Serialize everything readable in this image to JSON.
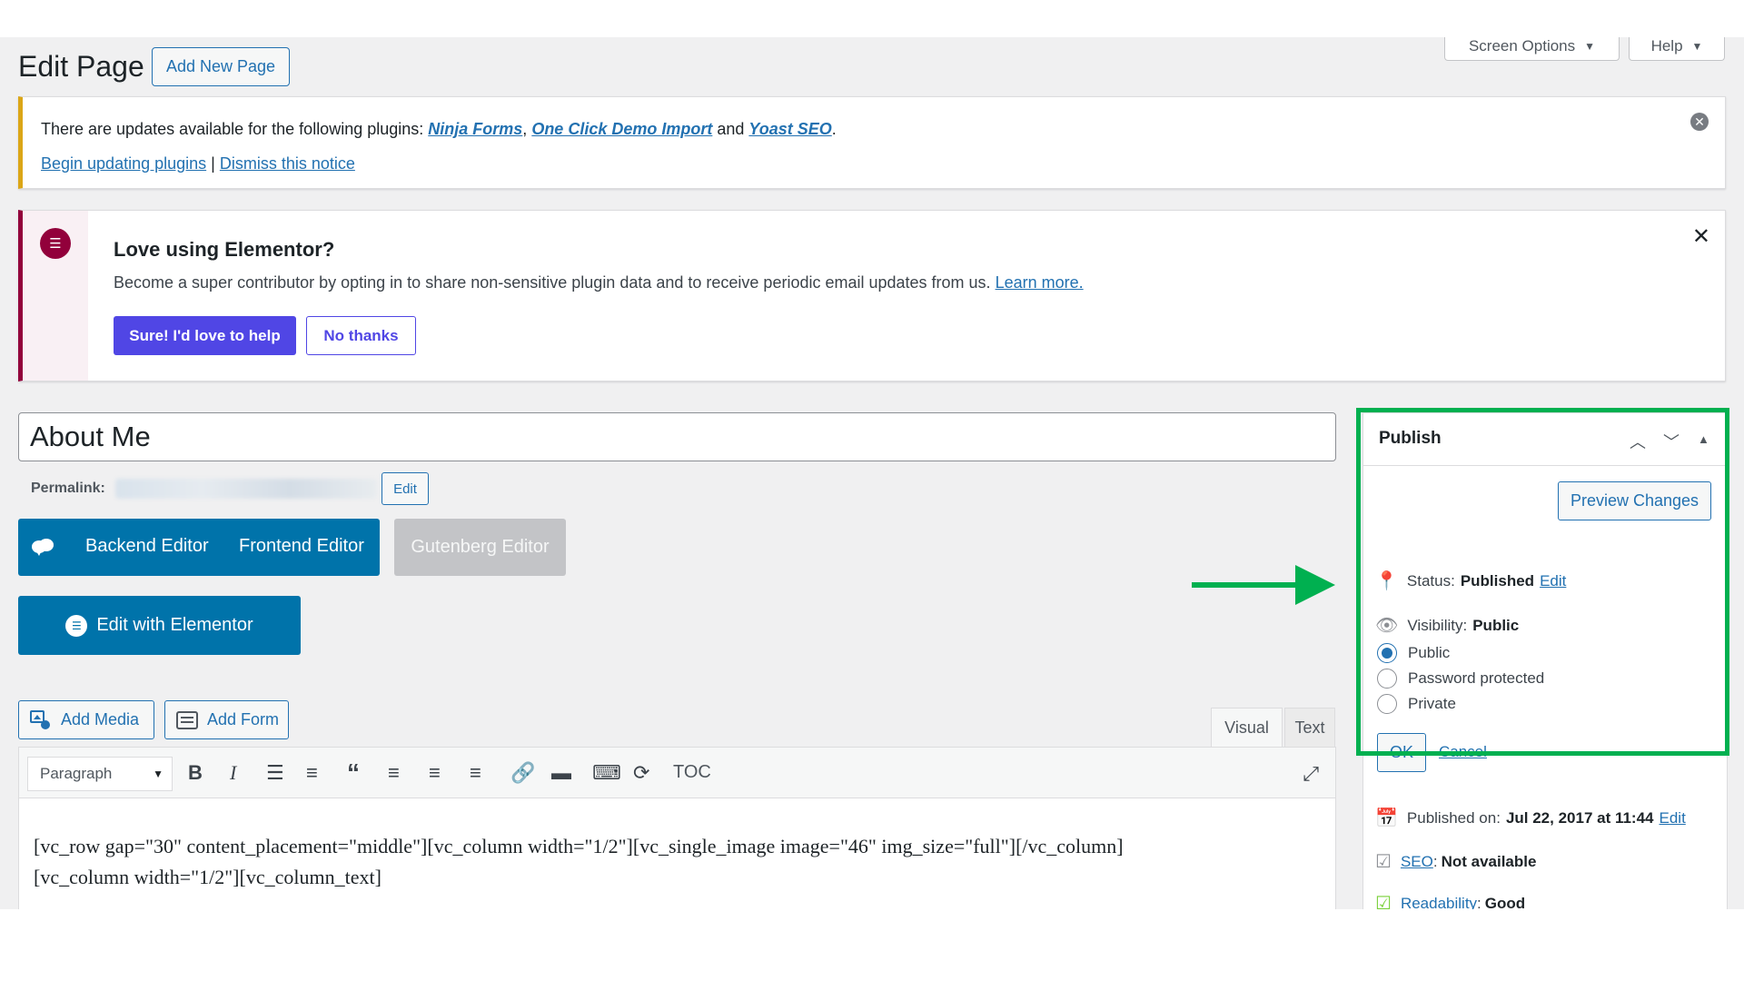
{
  "header": {
    "title": "Edit Page",
    "add_new_label": "Add New Page",
    "screen_options_label": "Screen Options",
    "help_label": "Help"
  },
  "plugin_notice": {
    "text_prefix": "There are updates available for the following plugins: ",
    "plugin_1": "Ninja Forms",
    "sep_1": ", ",
    "plugin_2": "One Click Demo Import",
    "sep_2": " and ",
    "plugin_3": "Yoast SEO",
    "text_suffix": ".",
    "begin_link": "Begin updating plugins",
    "divider": " | ",
    "dismiss_link": "Dismiss this notice"
  },
  "elementor_notice": {
    "title": "Love using Elementor?",
    "description": "Become a super contributor by opting in to share non-sensitive plugin data and to receive periodic email updates from us. ",
    "learn_more": "Learn more.",
    "yes_label": "Sure! I'd love to help",
    "no_label": "No thanks"
  },
  "post": {
    "title": "About Me",
    "permalink_label": "Permalink:",
    "permalink_edit": "Edit"
  },
  "editor_switch": {
    "backend": "Backend Editor",
    "frontend": "Frontend Editor",
    "gutenberg": "Gutenberg Editor",
    "elementor": "Edit with Elementor"
  },
  "media": {
    "add_media": "Add Media",
    "add_form": "Add Form"
  },
  "editor": {
    "tab_visual": "Visual",
    "tab_text": "Text",
    "format": "Paragraph",
    "toc": "TOC",
    "content_line_1": "[vc_row gap=\"30\" content_placement=\"middle\"][vc_column width=\"1/2\"][vc_single_image image=\"46\" img_size=\"full\"][/vc_column]",
    "content_line_2": "[vc_column width=\"1/2\"][vc_column_text]"
  },
  "publish": {
    "title": "Publish",
    "preview_label": "Preview Changes",
    "status_label": "Status:",
    "status_value": "Published",
    "status_edit": "Edit",
    "visibility_label": "Visibility:",
    "visibility_value": "Public",
    "options": [
      "Public",
      "Password protected",
      "Private"
    ],
    "selected_option": "Public",
    "ok_label": "OK",
    "cancel_label": "Cancel",
    "published_on_label": "Published on:",
    "published_on_value": "Jul 22, 2017 at 11:44",
    "published_on_edit": "Edit",
    "seo_link": "SEO",
    "seo_value": "Not available",
    "readability_link": "Readability",
    "readability_value": "Good"
  },
  "colors": {
    "wp_blue": "#2271b1",
    "editor_blue": "#0073aa",
    "elementor_purple": "#5046e5",
    "elementor_maroon": "#92003b",
    "notice_yellow": "#dba617",
    "highlight_green": "#00b050"
  }
}
